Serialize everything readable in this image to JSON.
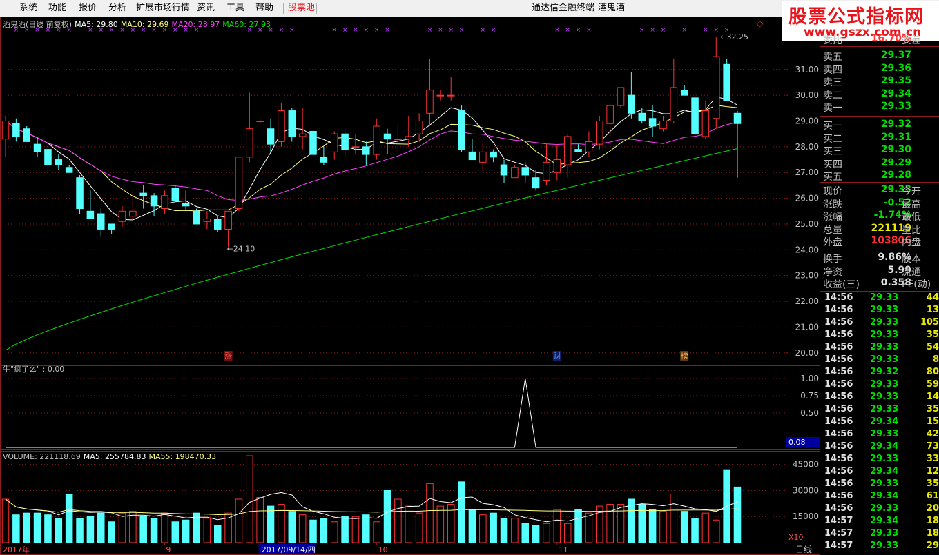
{
  "menu": {
    "items": [
      "系统",
      "功能",
      "报价",
      "分析",
      "扩展市场行情",
      "资讯",
      "工具",
      "帮助",
      "股票池"
    ],
    "app_title": "通达信金融终端",
    "stock_name": "酒鬼酒"
  },
  "watermark": {
    "line1": "股票公式指标网",
    "line2": "www.gszx.com.cn"
  },
  "main_chart": {
    "legend": {
      "title": "酒鬼酒(日线 前复权)",
      "ma5": "MA5: 29.80",
      "ma10": "MA10: 29.69",
      "ma20": "MA20: 28.97",
      "ma60": "MA60: 27.93"
    },
    "high_label": "32.25",
    "low_label": "24.10",
    "markers": [
      "涨",
      "财",
      "榜"
    ]
  },
  "indicator": {
    "legend": "牛\"疯了么\" : 0.00",
    "current_value": "0.08"
  },
  "volume": {
    "legend_volume": "VOLUME: 221118.69",
    "legend_ma5": "MA5: 255784.83",
    "legend_ma55": "MA55: 198470.33",
    "multiplier": "X10"
  },
  "date_axis": {
    "labels": [
      "2017年",
      "9",
      "2017/09/14/四",
      "10",
      "11"
    ],
    "period": "日线"
  },
  "colors": {
    "up": "#ff3232",
    "down": "#54ffff",
    "ma5": "#ffffff",
    "ma10": "#ffff80",
    "ma20": "#ff40ff",
    "ma60": "#00e000",
    "grid": "#8a1c1c"
  },
  "chart_data": [
    {
      "type": "candlestick",
      "title": "酒鬼酒(日线 前复权)",
      "y_axis_ticks": [
        "31.00",
        "30.00",
        "29.00",
        "28.00",
        "27.00",
        "26.00",
        "25.00",
        "24.00",
        "23.00",
        "22.00",
        "21.00",
        "20.00"
      ],
      "ylim": [
        19.7,
        32.6
      ],
      "candles": [
        {
          "o": 28.3,
          "h": 29.2,
          "l": 27.6,
          "c": 29.0
        },
        {
          "o": 28.9,
          "h": 29.1,
          "l": 28.2,
          "c": 28.4
        },
        {
          "o": 28.7,
          "h": 28.8,
          "l": 28.2,
          "c": 28.2
        },
        {
          "o": 28.1,
          "h": 28.4,
          "l": 27.6,
          "c": 27.8
        },
        {
          "o": 27.9,
          "h": 28.1,
          "l": 27.0,
          "c": 27.3
        },
        {
          "o": 27.5,
          "h": 27.7,
          "l": 27.1,
          "c": 27.3
        },
        {
          "o": 27.2,
          "h": 27.3,
          "l": 27.0,
          "c": 27.0
        },
        {
          "o": 26.8,
          "h": 26.9,
          "l": 25.4,
          "c": 25.6
        },
        {
          "o": 25.5,
          "h": 26.3,
          "l": 25.4,
          "c": 25.2
        },
        {
          "o": 25.4,
          "h": 25.6,
          "l": 24.5,
          "c": 24.8
        },
        {
          "o": 25.0,
          "h": 25.0,
          "l": 24.6,
          "c": 24.8
        },
        {
          "o": 25.1,
          "h": 25.7,
          "l": 24.9,
          "c": 25.5
        },
        {
          "o": 25.3,
          "h": 26.3,
          "l": 25.2,
          "c": 25.5
        },
        {
          "o": 26.2,
          "h": 26.5,
          "l": 25.6,
          "c": 26.1
        },
        {
          "o": 26.1,
          "h": 26.2,
          "l": 25.3,
          "c": 25.7
        },
        {
          "o": 25.6,
          "h": 26.3,
          "l": 25.4,
          "c": 26.1
        },
        {
          "o": 26.4,
          "h": 26.5,
          "l": 25.9,
          "c": 25.9
        },
        {
          "o": 25.8,
          "h": 26.3,
          "l": 25.5,
          "c": 25.7
        },
        {
          "o": 25.5,
          "h": 25.6,
          "l": 25.1,
          "c": 25.0
        },
        {
          "o": 25.1,
          "h": 25.5,
          "l": 24.8,
          "c": 25.2
        },
        {
          "o": 25.2,
          "h": 25.3,
          "l": 24.7,
          "c": 24.8
        },
        {
          "o": 24.8,
          "h": 25.4,
          "l": 24.1,
          "c": 25.5
        },
        {
          "o": 25.6,
          "h": 27.6,
          "l": 25.5,
          "c": 27.6
        },
        {
          "o": 27.6,
          "h": 30.1,
          "l": 27.4,
          "c": 28.7
        },
        {
          "o": 29.0,
          "h": 29.1,
          "l": 28.9,
          "c": 29.0
        },
        {
          "o": 28.7,
          "h": 29.1,
          "l": 27.8,
          "c": 28.1
        },
        {
          "o": 28.2,
          "h": 29.7,
          "l": 28.0,
          "c": 29.4
        },
        {
          "o": 29.4,
          "h": 29.5,
          "l": 28.2,
          "c": 28.4
        },
        {
          "o": 28.4,
          "h": 29.5,
          "l": 27.9,
          "c": 28.5
        },
        {
          "o": 28.6,
          "h": 28.8,
          "l": 27.5,
          "c": 27.7
        },
        {
          "o": 27.6,
          "h": 28.0,
          "l": 27.3,
          "c": 27.4
        },
        {
          "o": 27.8,
          "h": 28.6,
          "l": 27.5,
          "c": 28.5
        },
        {
          "o": 28.5,
          "h": 28.7,
          "l": 27.6,
          "c": 27.9
        },
        {
          "o": 28.0,
          "h": 28.5,
          "l": 27.7,
          "c": 28.0
        },
        {
          "o": 28.0,
          "h": 28.2,
          "l": 27.3,
          "c": 27.7
        },
        {
          "o": 27.7,
          "h": 29.1,
          "l": 27.5,
          "c": 28.8
        },
        {
          "o": 28.5,
          "h": 28.7,
          "l": 27.7,
          "c": 28.3
        },
        {
          "o": 28.3,
          "h": 28.9,
          "l": 27.7,
          "c": 28.3
        },
        {
          "o": 28.3,
          "h": 29.2,
          "l": 28.0,
          "c": 28.4
        },
        {
          "o": 28.5,
          "h": 29.3,
          "l": 28.2,
          "c": 29.0
        },
        {
          "o": 29.3,
          "h": 31.4,
          "l": 28.8,
          "c": 30.2
        },
        {
          "o": 30.0,
          "h": 30.2,
          "l": 29.8,
          "c": 30.0
        },
        {
          "o": 30.0,
          "h": 30.7,
          "l": 29.8,
          "c": 30.0
        },
        {
          "o": 29.4,
          "h": 29.6,
          "l": 27.8,
          "c": 27.9
        },
        {
          "o": 27.8,
          "h": 28.3,
          "l": 27.5,
          "c": 27.5
        },
        {
          "o": 27.4,
          "h": 28.2,
          "l": 27.0,
          "c": 27.8
        },
        {
          "o": 27.8,
          "h": 27.9,
          "l": 27.4,
          "c": 27.6
        },
        {
          "o": 27.3,
          "h": 27.5,
          "l": 26.6,
          "c": 26.9
        },
        {
          "o": 26.8,
          "h": 27.3,
          "l": 26.8,
          "c": 27.2
        },
        {
          "o": 27.2,
          "h": 27.4,
          "l": 26.6,
          "c": 26.9
        },
        {
          "o": 26.8,
          "h": 27.1,
          "l": 26.3,
          "c": 26.4
        },
        {
          "o": 26.7,
          "h": 28.1,
          "l": 26.5,
          "c": 27.4
        },
        {
          "o": 27.0,
          "h": 28.1,
          "l": 26.7,
          "c": 27.5
        },
        {
          "o": 27.3,
          "h": 28.5,
          "l": 26.8,
          "c": 28.4
        },
        {
          "o": 27.9,
          "h": 28.1,
          "l": 27.8,
          "c": 27.8
        },
        {
          "o": 27.8,
          "h": 28.6,
          "l": 27.6,
          "c": 28.2
        },
        {
          "o": 28.1,
          "h": 29.2,
          "l": 27.9,
          "c": 29.0
        },
        {
          "o": 28.9,
          "h": 29.7,
          "l": 28.4,
          "c": 29.6
        },
        {
          "o": 29.6,
          "h": 30.2,
          "l": 29.5,
          "c": 30.3
        },
        {
          "o": 30.0,
          "h": 30.9,
          "l": 29.1,
          "c": 29.3
        },
        {
          "o": 29.3,
          "h": 29.5,
          "l": 28.9,
          "c": 29.0
        },
        {
          "o": 29.1,
          "h": 29.6,
          "l": 28.4,
          "c": 28.8
        },
        {
          "o": 28.7,
          "h": 29.2,
          "l": 28.6,
          "c": 29.0
        },
        {
          "o": 29.0,
          "h": 31.4,
          "l": 28.9,
          "c": 30.3
        },
        {
          "o": 30.2,
          "h": 30.4,
          "l": 30.0,
          "c": 30.0
        },
        {
          "o": 29.9,
          "h": 30.1,
          "l": 28.3,
          "c": 28.5
        },
        {
          "o": 28.4,
          "h": 29.8,
          "l": 28.3,
          "c": 29.4
        },
        {
          "o": 29.1,
          "h": 32.25,
          "l": 28.7,
          "c": 31.5
        },
        {
          "o": 31.2,
          "h": 31.4,
          "l": 29.8,
          "c": 29.8
        },
        {
          "o": 29.3,
          "h": 29.4,
          "l": 26.8,
          "c": 28.9
        }
      ],
      "ma5": [
        29.8
      ],
      "ma10": [
        29.69
      ],
      "ma20": [
        28.97
      ],
      "ma60": [
        27.93
      ]
    },
    {
      "type": "line",
      "title": "牛\"疯了么\"",
      "y_axis_ticks": [
        "1.00",
        "0.75",
        "0.50"
      ],
      "ylim": [
        0,
        1.0
      ],
      "values": [
        0,
        0,
        0,
        0,
        0,
        0,
        0,
        0,
        0,
        0,
        0,
        0,
        0,
        0,
        0,
        0,
        0,
        0,
        0,
        0,
        0,
        0,
        0,
        0,
        0,
        0,
        0,
        0,
        0,
        0,
        0,
        0,
        0,
        0,
        0,
        0,
        0,
        0,
        0,
        0,
        0,
        0,
        0,
        0,
        0,
        0,
        0,
        0,
        0,
        1,
        0,
        0,
        0,
        0,
        0,
        0,
        0,
        0,
        0,
        0,
        0,
        0,
        0,
        0,
        0,
        0,
        0,
        0,
        0,
        0
      ]
    },
    {
      "type": "bar",
      "title": "VOLUME",
      "y_axis_ticks": [
        "45000",
        "30000",
        "15000"
      ],
      "ylim": [
        0,
        52000
      ],
      "values": [
        25000,
        16000,
        17000,
        17000,
        16000,
        14000,
        28000,
        14000,
        15000,
        17000,
        12000,
        17000,
        18000,
        15000,
        14000,
        17000,
        12000,
        13000,
        17000,
        14000,
        10000,
        17000,
        25000,
        50000,
        26000,
        21000,
        22000,
        18000,
        16000,
        13000,
        14000,
        12000,
        15000,
        15000,
        16000,
        12000,
        30000,
        25000,
        21000,
        17000,
        34000,
        21000,
        22000,
        35000,
        19000,
        16000,
        17000,
        14000,
        14000,
        11000,
        10000,
        11000,
        19000,
        11000,
        19000,
        17000,
        21000,
        22000,
        22000,
        25000,
        22000,
        19000,
        18000,
        28000,
        18000,
        14000,
        17000,
        13000,
        42000,
        32000,
        22000
      ]
    }
  ],
  "quote_panel": {
    "top_partial": {
      "label": "委比",
      "value": "16.70%",
      "right": "委差"
    },
    "sells": [
      {
        "label": "卖五",
        "price": "29.37"
      },
      {
        "label": "卖四",
        "price": "29.36"
      },
      {
        "label": "卖三",
        "price": "29.35"
      },
      {
        "label": "卖二",
        "price": "29.34"
      },
      {
        "label": "卖一",
        "price": "29.33"
      }
    ],
    "buys": [
      {
        "label": "买一",
        "price": "29.32"
      },
      {
        "label": "买二",
        "price": "29.31"
      },
      {
        "label": "买三",
        "price": "29.30"
      },
      {
        "label": "买四",
        "price": "29.29"
      },
      {
        "label": "买五",
        "price": "29.28"
      }
    ],
    "stats": [
      {
        "label": "现价",
        "value": "29.33",
        "right": "今开",
        "color": "#00e000"
      },
      {
        "label": "涨跌",
        "value": "-0.52",
        "right": "最高",
        "color": "#00e000"
      },
      {
        "label": "涨幅",
        "value": "-1.74%",
        "right": "最低",
        "color": "#00e000"
      },
      {
        "label": "总量",
        "value": "221119",
        "right": "量比",
        "color": "#e8e800"
      },
      {
        "label": "外盘",
        "value": "103806",
        "right": "内盘",
        "color": "#ff3232"
      }
    ],
    "fundamentals": [
      {
        "label": "换手",
        "value": "9.86%",
        "right": "股本"
      },
      {
        "label": "净资",
        "value": "5.99",
        "right": "流通"
      },
      {
        "label": "收益(三)",
        "value": "0.358",
        "right": "PE(动)"
      }
    ],
    "ticks": [
      {
        "time": "14:56",
        "price": "29.33",
        "vol": "44"
      },
      {
        "time": "14:56",
        "price": "29.33",
        "vol": "13"
      },
      {
        "time": "14:56",
        "price": "29.33",
        "vol": "105"
      },
      {
        "time": "14:56",
        "price": "29.33",
        "vol": "35"
      },
      {
        "time": "14:56",
        "price": "29.33",
        "vol": "54"
      },
      {
        "time": "14:56",
        "price": "29.33",
        "vol": "8"
      },
      {
        "time": "14:56",
        "price": "29.32",
        "vol": "80"
      },
      {
        "time": "14:56",
        "price": "29.33",
        "vol": "59"
      },
      {
        "time": "14:56",
        "price": "29.33",
        "vol": "14"
      },
      {
        "time": "14:56",
        "price": "29.33",
        "vol": "35"
      },
      {
        "time": "14:56",
        "price": "29.34",
        "vol": "15"
      },
      {
        "time": "14:56",
        "price": "29.33",
        "vol": "42"
      },
      {
        "time": "14:56",
        "price": "29.34",
        "vol": "73"
      },
      {
        "time": "14:56",
        "price": "29.33",
        "vol": "33"
      },
      {
        "time": "14:56",
        "price": "29.34",
        "vol": "12"
      },
      {
        "time": "14:56",
        "price": "29.33",
        "vol": "35"
      },
      {
        "time": "14:56",
        "price": "29.34",
        "vol": "61"
      },
      {
        "time": "14:56",
        "price": "29.33",
        "vol": "20"
      },
      {
        "time": "14:57",
        "price": "29.34",
        "vol": "18"
      },
      {
        "time": "14:57",
        "price": "29.33",
        "vol": "18"
      },
      {
        "time": "14:57",
        "price": "29.33",
        "vol": "29"
      }
    ]
  }
}
